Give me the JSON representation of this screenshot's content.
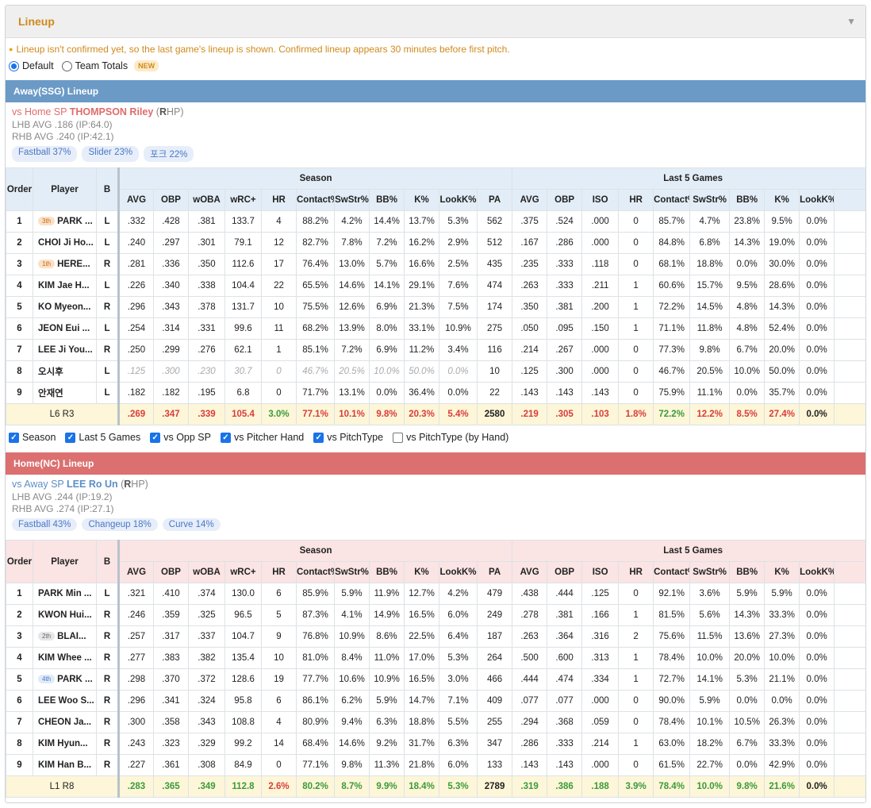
{
  "title": "Lineup",
  "notice": "Lineup isn't confirmed yet, so the last game's lineup is shown. Confirmed lineup appears 30 minutes before first pitch.",
  "view_options": [
    {
      "label": "Default",
      "checked": true
    },
    {
      "label": "Team Totals",
      "checked": false,
      "badge": "NEW"
    }
  ],
  "table_headers": {
    "order": "Order",
    "player": "Player",
    "b": "B",
    "season": "Season",
    "last5": "Last 5 Games",
    "season_cols": [
      "AVG",
      "OBP",
      "wOBA",
      "wRC+",
      "HR",
      "Contact%",
      "SwStr%",
      "BB%",
      "K%",
      "LookK%",
      "PA"
    ],
    "last5_cols": [
      "AVG",
      "OBP",
      "ISO",
      "HR",
      "Contact%",
      "SwStr%",
      "BB%",
      "K%",
      "LookK%"
    ]
  },
  "away": {
    "header": "Away(SSG) Lineup",
    "sp_prefix": "vs Home SP",
    "sp_name": "THOMPSON Riley",
    "sp_hand_bold": "R",
    "sp_hand_rest": "HP",
    "lhb": "LHB AVG .186 (IP:64.0)",
    "rhb": "RHB AVG .240 (IP:42.1)",
    "pitches": [
      "Fastball 37%",
      "Slider 23%",
      "포크 22%"
    ],
    "rows": [
      {
        "order": "1",
        "tag": "3th",
        "tagc": "o",
        "player": "PARK ...",
        "b": "L",
        "season": [
          ".332",
          ".428",
          ".381",
          "133.7",
          "4",
          "88.2%",
          "4.2%",
          "14.4%",
          "13.7%",
          "5.3%",
          "562"
        ],
        "last5": [
          ".375",
          ".524",
          ".000",
          "0",
          "85.7%",
          "4.7%",
          "23.8%",
          "9.5%",
          "0.0%"
        ]
      },
      {
        "order": "2",
        "tag": "",
        "tagc": "",
        "player": "CHOI Ji Ho...",
        "b": "L",
        "season": [
          ".240",
          ".297",
          ".301",
          "79.1",
          "12",
          "82.7%",
          "7.8%",
          "7.2%",
          "16.2%",
          "2.9%",
          "512"
        ],
        "last5": [
          ".167",
          ".286",
          ".000",
          "0",
          "84.8%",
          "6.8%",
          "14.3%",
          "19.0%",
          "0.0%"
        ]
      },
      {
        "order": "3",
        "tag": "1th",
        "tagc": "o",
        "player": "HERE...",
        "b": "R",
        "season": [
          ".281",
          ".336",
          ".350",
          "112.6",
          "17",
          "76.4%",
          "13.0%",
          "5.7%",
          "16.6%",
          "2.5%",
          "435"
        ],
        "last5": [
          ".235",
          ".333",
          ".118",
          "0",
          "68.1%",
          "18.8%",
          "0.0%",
          "30.0%",
          "0.0%"
        ]
      },
      {
        "order": "4",
        "tag": "",
        "tagc": "",
        "player": "KIM Jae H...",
        "b": "L",
        "season": [
          ".226",
          ".340",
          ".338",
          "104.4",
          "22",
          "65.5%",
          "14.6%",
          "14.1%",
          "29.1%",
          "7.6%",
          "474"
        ],
        "last5": [
          ".263",
          ".333",
          ".211",
          "1",
          "60.6%",
          "15.7%",
          "9.5%",
          "28.6%",
          "0.0%"
        ]
      },
      {
        "order": "5",
        "tag": "",
        "tagc": "",
        "player": "KO Myeon...",
        "b": "R",
        "season": [
          ".296",
          ".343",
          ".378",
          "131.7",
          "10",
          "75.5%",
          "12.6%",
          "6.9%",
          "21.3%",
          "7.5%",
          "174"
        ],
        "last5": [
          ".350",
          ".381",
          ".200",
          "1",
          "72.2%",
          "14.5%",
          "4.8%",
          "14.3%",
          "0.0%"
        ]
      },
      {
        "order": "6",
        "tag": "",
        "tagc": "",
        "player": "JEON Eui ...",
        "b": "L",
        "season": [
          ".254",
          ".314",
          ".331",
          "99.6",
          "11",
          "68.2%",
          "13.9%",
          "8.0%",
          "33.1%",
          "10.9%",
          "275"
        ],
        "last5": [
          ".050",
          ".095",
          ".150",
          "1",
          "71.1%",
          "11.8%",
          "4.8%",
          "52.4%",
          "0.0%"
        ]
      },
      {
        "order": "7",
        "tag": "",
        "tagc": "",
        "player": "LEE Ji You...",
        "b": "R",
        "season": [
          ".250",
          ".299",
          ".276",
          "62.1",
          "1",
          "85.1%",
          "7.2%",
          "6.9%",
          "11.2%",
          "3.4%",
          "116"
        ],
        "last5": [
          ".214",
          ".267",
          ".000",
          "0",
          "77.3%",
          "9.8%",
          "6.7%",
          "20.0%",
          "0.0%"
        ]
      },
      {
        "order": "8",
        "tag": "",
        "tagc": "",
        "player": "오시후",
        "b": "L",
        "faded": true,
        "season": [
          ".125",
          ".300",
          ".230",
          "30.7",
          "0",
          "46.7%",
          "20.5%",
          "10.0%",
          "50.0%",
          "0.0%",
          "10"
        ],
        "last5": [
          ".125",
          ".300",
          ".000",
          "0",
          "46.7%",
          "20.5%",
          "10.0%",
          "50.0%",
          "0.0%"
        ]
      },
      {
        "order": "9",
        "tag": "",
        "tagc": "",
        "player": "안재연",
        "b": "L",
        "season": [
          ".182",
          ".182",
          ".195",
          "6.8",
          "0",
          "71.7%",
          "13.1%",
          "0.0%",
          "36.4%",
          "0.0%",
          "22"
        ],
        "last5": [
          ".143",
          ".143",
          ".143",
          "0",
          "75.9%",
          "11.1%",
          "0.0%",
          "35.7%",
          "0.0%"
        ]
      }
    ],
    "total": {
      "label_l": "L6",
      "label_r": "R3",
      "season": [
        ".269",
        ".347",
        ".339",
        "105.4",
        "3.0%",
        "77.1%",
        "10.1%",
        "9.8%",
        "20.3%",
        "5.4%",
        "2580"
      ],
      "season_colors": [
        "red",
        "red",
        "red",
        "red",
        "green",
        "red",
        "red",
        "red",
        "red",
        "red",
        "black"
      ],
      "last5": [
        ".219",
        ".305",
        ".103",
        "1.8%",
        "72.2%",
        "12.2%",
        "8.5%",
        "27.4%",
        "0.0%"
      ],
      "last5_colors": [
        "red",
        "red",
        "red",
        "red",
        "green",
        "red",
        "red",
        "red",
        "black"
      ]
    }
  },
  "filters": [
    {
      "label": "Season",
      "checked": true
    },
    {
      "label": "Last 5 Games",
      "checked": true
    },
    {
      "label": "vs Opp SP",
      "checked": true
    },
    {
      "label": "vs Pitcher Hand",
      "checked": true
    },
    {
      "label": "vs PitchType",
      "checked": true
    },
    {
      "label": "vs PitchType (by Hand)",
      "checked": false
    }
  ],
  "home": {
    "header": "Home(NC) Lineup",
    "sp_prefix": "vs Away SP",
    "sp_name": "LEE Ro Un",
    "sp_hand_bold": "R",
    "sp_hand_rest": "HP",
    "lhb": "LHB AVG .244 (IP:19.2)",
    "rhb": "RHB AVG .274 (IP:27.1)",
    "pitches": [
      "Fastball 43%",
      "Changeup 18%",
      "Curve 14%"
    ],
    "rows": [
      {
        "order": "1",
        "tag": "",
        "tagc": "",
        "player": "PARK Min ...",
        "b": "L",
        "season": [
          ".321",
          ".410",
          ".374",
          "130.0",
          "6",
          "85.9%",
          "5.9%",
          "11.9%",
          "12.7%",
          "4.2%",
          "479"
        ],
        "last5": [
          ".438",
          ".444",
          ".125",
          "0",
          "92.1%",
          "3.6%",
          "5.9%",
          "5.9%",
          "0.0%"
        ]
      },
      {
        "order": "2",
        "tag": "",
        "tagc": "",
        "player": "KWON Hui...",
        "b": "R",
        "season": [
          ".246",
          ".359",
          ".325",
          "96.5",
          "5",
          "87.3%",
          "4.1%",
          "14.9%",
          "16.5%",
          "6.0%",
          "249"
        ],
        "last5": [
          ".278",
          ".381",
          ".166",
          "1",
          "81.5%",
          "5.6%",
          "14.3%",
          "33.3%",
          "0.0%"
        ]
      },
      {
        "order": "3",
        "tag": "2th",
        "tagc": "g",
        "player": "BLAI...",
        "b": "R",
        "season": [
          ".257",
          ".317",
          ".337",
          "104.7",
          "9",
          "76.8%",
          "10.9%",
          "8.6%",
          "22.5%",
          "6.4%",
          "187"
        ],
        "last5": [
          ".263",
          ".364",
          ".316",
          "2",
          "75.6%",
          "11.5%",
          "13.6%",
          "27.3%",
          "0.0%"
        ]
      },
      {
        "order": "4",
        "tag": "",
        "tagc": "",
        "player": "KIM Whee ...",
        "b": "R",
        "season": [
          ".277",
          ".383",
          ".382",
          "135.4",
          "10",
          "81.0%",
          "8.4%",
          "11.0%",
          "17.0%",
          "5.3%",
          "264"
        ],
        "last5": [
          ".500",
          ".600",
          ".313",
          "1",
          "78.4%",
          "10.0%",
          "20.0%",
          "10.0%",
          "0.0%"
        ]
      },
      {
        "order": "5",
        "tag": "4th",
        "tagc": "b",
        "player": "PARK ...",
        "b": "R",
        "season": [
          ".298",
          ".370",
          ".372",
          "128.6",
          "19",
          "77.7%",
          "10.6%",
          "10.9%",
          "16.5%",
          "3.0%",
          "466"
        ],
        "last5": [
          ".444",
          ".474",
          ".334",
          "1",
          "72.7%",
          "14.1%",
          "5.3%",
          "21.1%",
          "0.0%"
        ]
      },
      {
        "order": "6",
        "tag": "",
        "tagc": "",
        "player": "LEE Woo S...",
        "b": "R",
        "season": [
          ".296",
          ".341",
          ".324",
          "95.8",
          "6",
          "86.1%",
          "6.2%",
          "5.9%",
          "14.7%",
          "7.1%",
          "409"
        ],
        "last5": [
          ".077",
          ".077",
          ".000",
          "0",
          "90.0%",
          "5.9%",
          "0.0%",
          "0.0%",
          "0.0%"
        ]
      },
      {
        "order": "7",
        "tag": "",
        "tagc": "",
        "player": "CHEON Ja...",
        "b": "R",
        "season": [
          ".300",
          ".358",
          ".343",
          "108.8",
          "4",
          "80.9%",
          "9.4%",
          "6.3%",
          "18.8%",
          "5.5%",
          "255"
        ],
        "last5": [
          ".294",
          ".368",
          ".059",
          "0",
          "78.4%",
          "10.1%",
          "10.5%",
          "26.3%",
          "0.0%"
        ]
      },
      {
        "order": "8",
        "tag": "",
        "tagc": "",
        "player": "KIM Hyun...",
        "b": "R",
        "season": [
          ".243",
          ".323",
          ".329",
          "99.2",
          "14",
          "68.4%",
          "14.6%",
          "9.2%",
          "31.7%",
          "6.3%",
          "347"
        ],
        "last5": [
          ".286",
          ".333",
          ".214",
          "1",
          "63.0%",
          "18.2%",
          "6.7%",
          "33.3%",
          "0.0%"
        ]
      },
      {
        "order": "9",
        "tag": "",
        "tagc": "",
        "player": "KIM Han B...",
        "b": "R",
        "season": [
          ".227",
          ".361",
          ".308",
          "84.9",
          "0",
          "77.1%",
          "9.8%",
          "11.3%",
          "21.8%",
          "6.0%",
          "133"
        ],
        "last5": [
          ".143",
          ".143",
          ".000",
          "0",
          "61.5%",
          "22.7%",
          "0.0%",
          "42.9%",
          "0.0%"
        ]
      }
    ],
    "total": {
      "label_l": "L1",
      "label_r": "R8",
      "season": [
        ".283",
        ".365",
        ".349",
        "112.8",
        "2.6%",
        "80.2%",
        "8.7%",
        "9.9%",
        "18.4%",
        "5.3%",
        "2789"
      ],
      "season_colors": [
        "green",
        "green",
        "green",
        "green",
        "red",
        "green",
        "green",
        "green",
        "green",
        "green",
        "black"
      ],
      "last5": [
        ".319",
        ".386",
        ".188",
        "3.9%",
        "78.4%",
        "10.0%",
        "9.8%",
        "21.6%",
        "0.0%"
      ],
      "last5_colors": [
        "green",
        "green",
        "green",
        "green",
        "green",
        "green",
        "green",
        "green",
        "black"
      ]
    }
  }
}
